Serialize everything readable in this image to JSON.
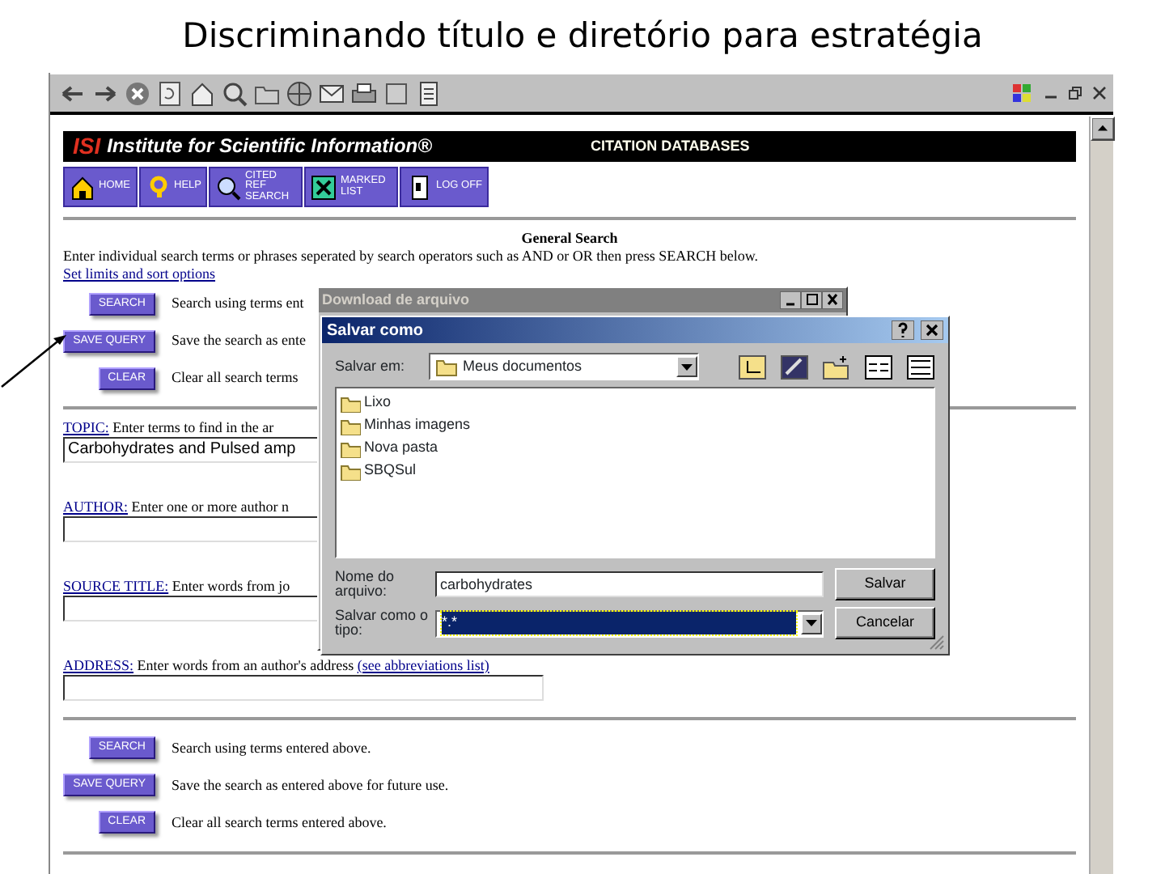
{
  "slide": {
    "title": "Discriminando título e diretório para estratégia"
  },
  "banner": {
    "logo": "ISI",
    "title": "Institute for Scientific Information®",
    "product": "CITATION DATABASES"
  },
  "nav_buttons": [
    {
      "label": "HOME"
    },
    {
      "label": "HELP"
    },
    {
      "label": "CITED REF SEARCH"
    },
    {
      "label": "MARKED LIST"
    },
    {
      "label": "LOG OFF"
    }
  ],
  "form": {
    "heading": "General Search",
    "instructions": "Enter individual search terms or phrases seperated by search operators such as AND or OR then press SEARCH below.",
    "options_link": "Set limits and sort options",
    "top_actions": [
      {
        "button": "SEARCH",
        "description": "Search using terms ent"
      },
      {
        "button": "SAVE QUERY",
        "description": "Save the search as ente"
      },
      {
        "button": "CLEAR",
        "description": "Clear all search terms"
      }
    ],
    "fields": [
      {
        "label": "TOPIC:",
        "hint": "Enter terms to find in the ar",
        "value": "Carbohydrates and Pulsed amp"
      },
      {
        "label": "AUTHOR:",
        "hint": "Enter one or more author n"
      },
      {
        "label": "SOURCE TITLE:",
        "hint": "Enter words from jo"
      },
      {
        "label": "ADDRESS:",
        "hint": "Enter words from an author's address",
        "link": "(see abbreviations list)"
      }
    ],
    "bottom_actions": [
      {
        "button": "SEARCH",
        "description": "Search using terms entered above."
      },
      {
        "button": "SAVE QUERY",
        "description": "Save the search as entered above for future use."
      },
      {
        "button": "CLEAR",
        "description": "Clear all search terms entered above."
      }
    ]
  },
  "download_window": {
    "title": "Download de arquivo",
    "active": false
  },
  "save_dialog": {
    "title": "Salvar como",
    "active": true,
    "look_in_label": "Salvar em:",
    "look_in": "Meus documentos",
    "files": [
      {
        "name": "Lixo"
      },
      {
        "name": "Minhas imagens"
      },
      {
        "name": "Nova pasta"
      },
      {
        "name": "SBQSul"
      }
    ],
    "filename_label": "Nome do arquivo:",
    "filename": "carbohydrates",
    "type_label": "Salvar como o tipo:",
    "type": "*.*",
    "type_selected": true,
    "buttons": [
      "Salvar",
      "Cancelar"
    ]
  }
}
